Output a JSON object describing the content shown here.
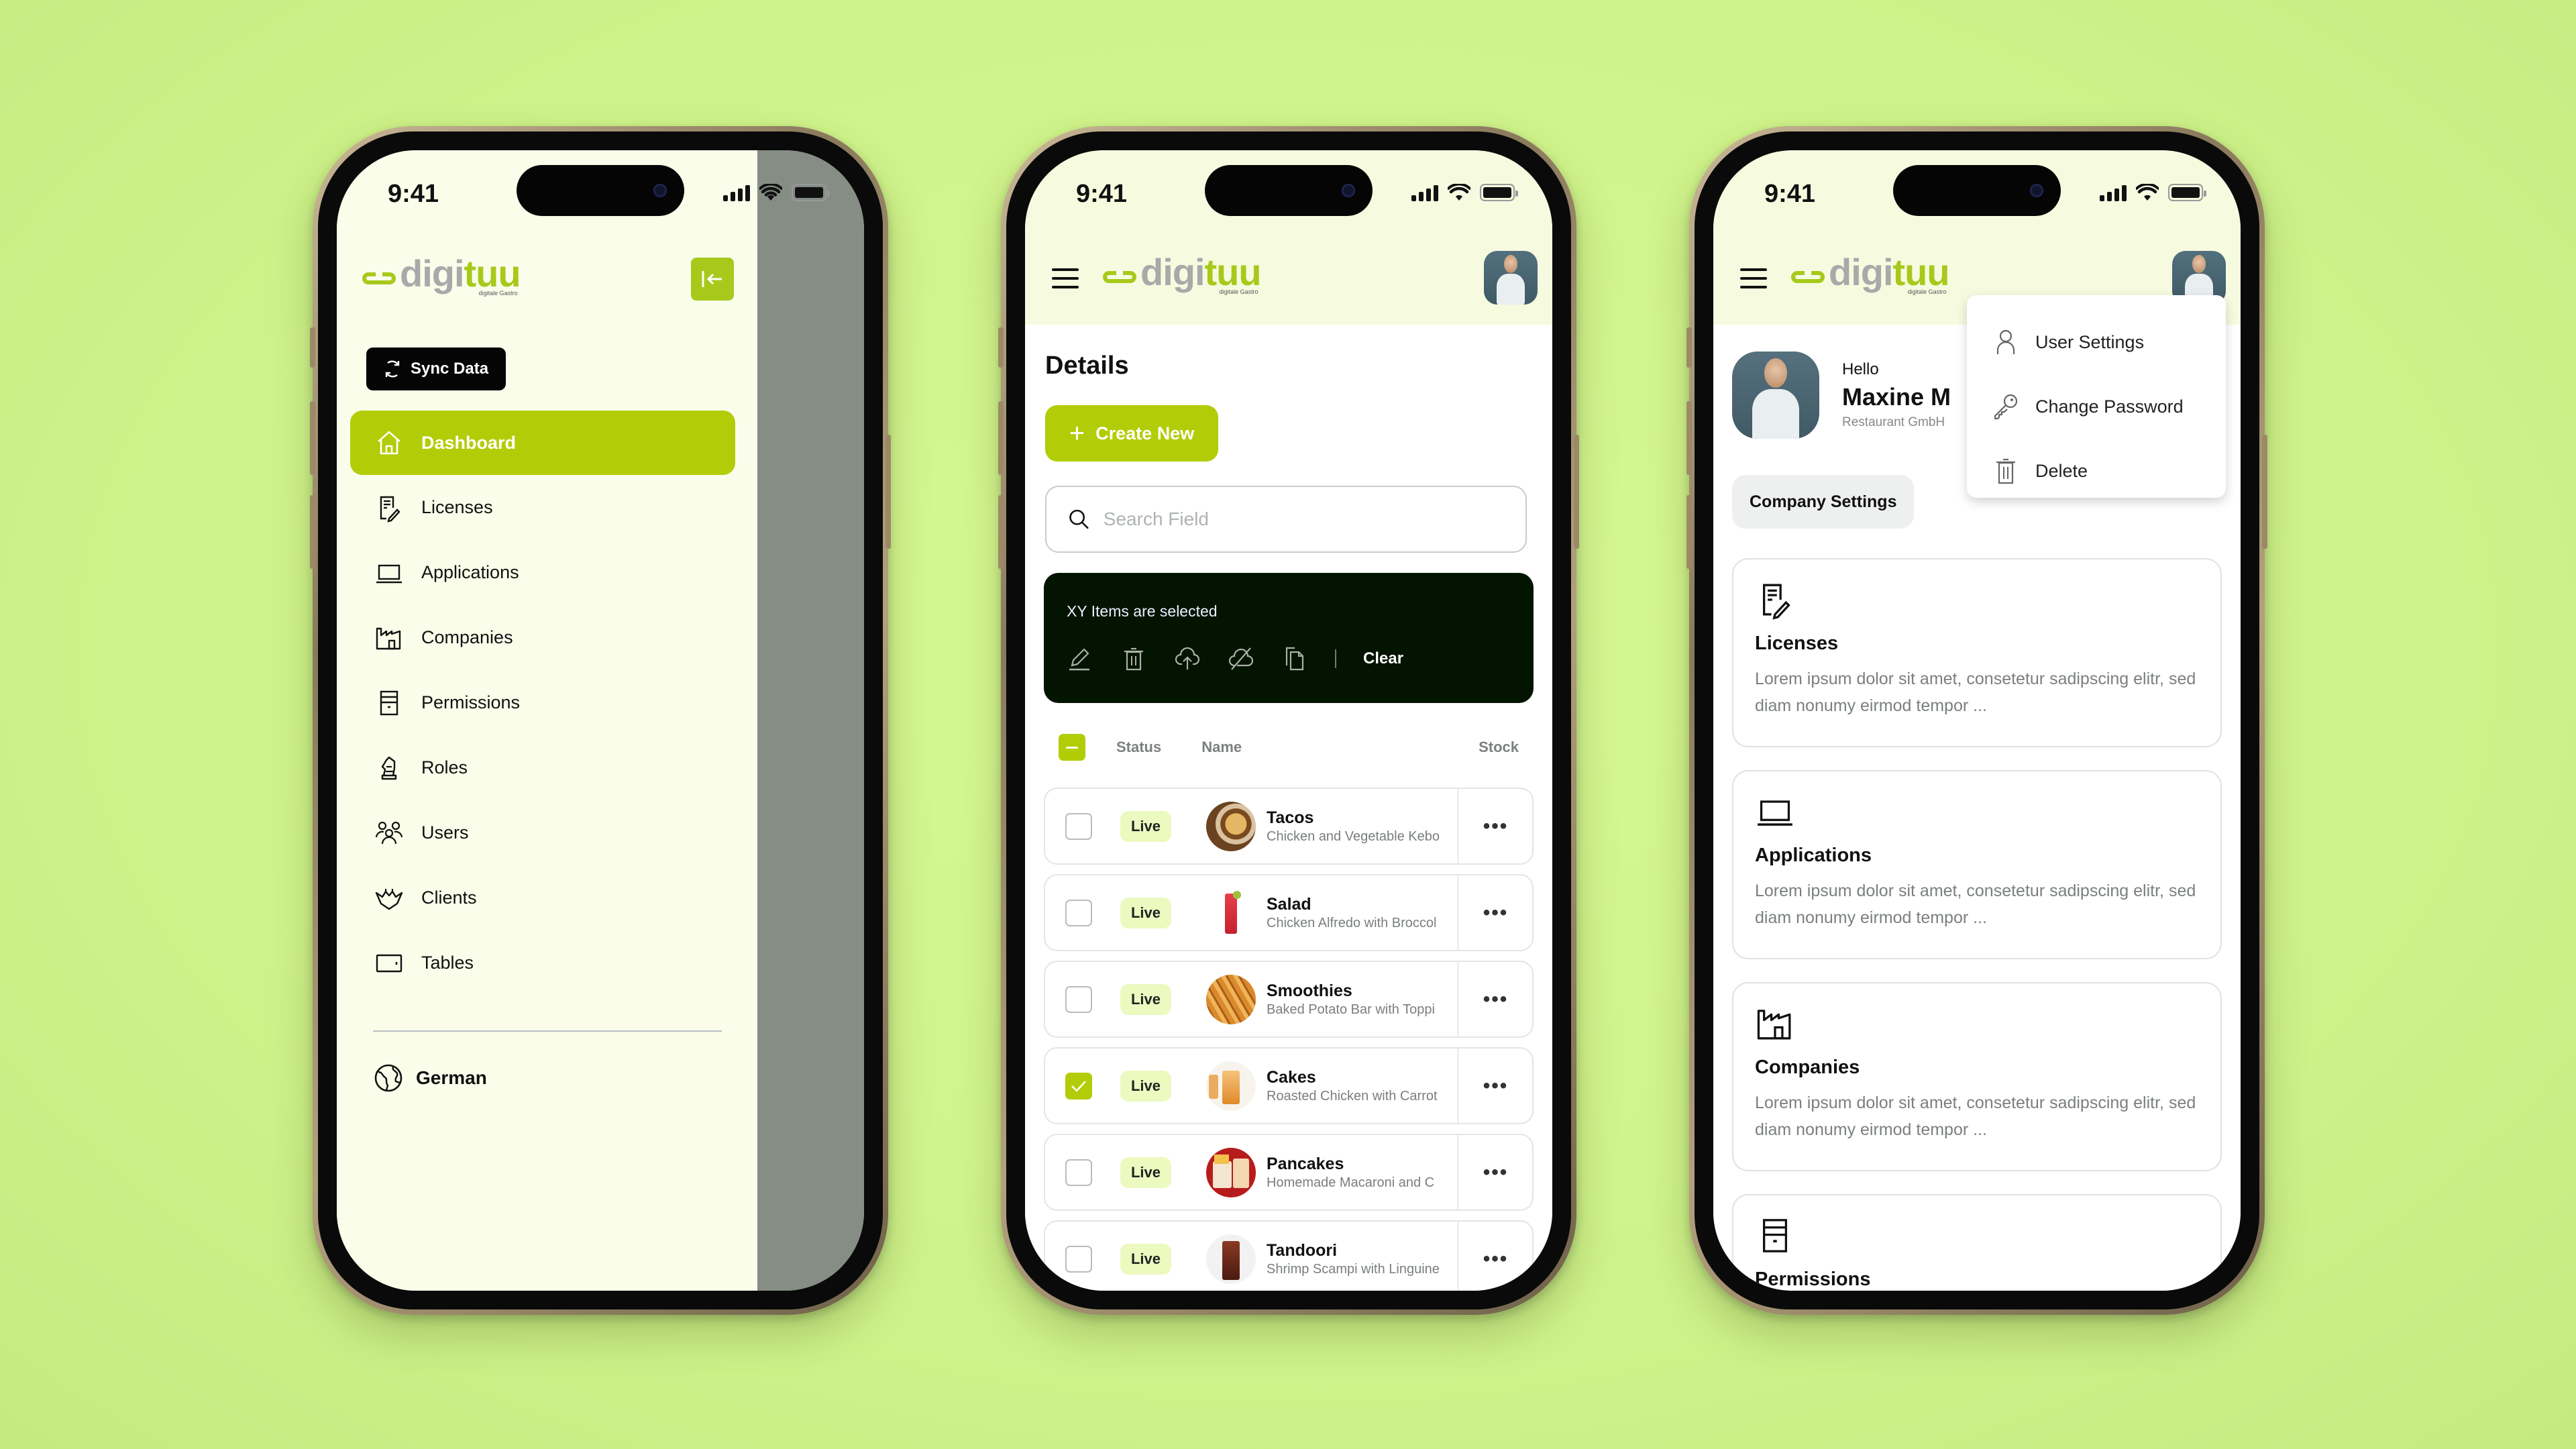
{
  "status_bar": {
    "time": "9:41"
  },
  "brand": {
    "name_part1": "digi",
    "name_part2": "tuu",
    "tagline": "digitale Gastro",
    "accent": "#b2cd07",
    "background": "#d4f78f"
  },
  "phone1": {
    "collapse_icon": "collapse-left-icon",
    "sync_button": "Sync Data",
    "nav": [
      {
        "label": "Dashboard",
        "icon": "home-icon",
        "active": true
      },
      {
        "label": "Licenses",
        "icon": "license-icon",
        "active": false
      },
      {
        "label": "Applications",
        "icon": "laptop-icon",
        "active": false
      },
      {
        "label": "Companies",
        "icon": "factory-icon",
        "active": false
      },
      {
        "label": "Permissions",
        "icon": "cabinet-icon",
        "active": false
      },
      {
        "label": "Roles",
        "icon": "chess-knight-icon",
        "active": false
      },
      {
        "label": "Users",
        "icon": "users-icon",
        "active": false
      },
      {
        "label": "Clients",
        "icon": "crown-icon",
        "active": false
      },
      {
        "label": "Tables",
        "icon": "table-icon",
        "active": false
      }
    ],
    "language": "German"
  },
  "phone2": {
    "title": "Details",
    "create_button": "Create New",
    "search": {
      "placeholder": "Search Field",
      "value": ""
    },
    "selection_bar": {
      "text": "XY Items are selected",
      "actions": [
        "edit-icon",
        "trash-icon",
        "cloud-upload-icon",
        "cloud-off-icon",
        "copy-icon"
      ],
      "clear_label": "Clear"
    },
    "table": {
      "columns": [
        "Status",
        "Name",
        "Stock"
      ],
      "rows": [
        {
          "checked": false,
          "status": "Live",
          "name": "Tacos",
          "description": "Chicken and Vegetable Kebo"
        },
        {
          "checked": false,
          "status": "Live",
          "name": "Salad",
          "description": "Chicken Alfredo with Broccol"
        },
        {
          "checked": false,
          "status": "Live",
          "name": "Smoothies",
          "description": "Baked Potato Bar with Toppi"
        },
        {
          "checked": true,
          "status": "Live",
          "name": "Cakes",
          "description": "Roasted Chicken with Carrot"
        },
        {
          "checked": false,
          "status": "Live",
          "name": "Pancakes",
          "description": "Homemade Macaroni and C"
        },
        {
          "checked": false,
          "status": "Live",
          "name": "Tandoori",
          "description": "Shrimp Scampi with Linguine"
        }
      ],
      "row_menu": "•••"
    }
  },
  "phone3": {
    "greeting": "Hello",
    "user_name": "Maxine M",
    "company": "Restaurant GmbH",
    "company_settings_button": "Company Settings",
    "dropdown": [
      {
        "label": "User Settings",
        "icon": "user-icon"
      },
      {
        "label": "Change Password",
        "icon": "key-icon"
      },
      {
        "label": "Delete",
        "icon": "trash-icon"
      }
    ],
    "cards": [
      {
        "title": "Licenses",
        "icon": "license-icon",
        "description": "Lorem ipsum dolor sit amet, consetetur sadipscing elitr, sed diam nonumy eirmod tempor ..."
      },
      {
        "title": "Applications",
        "icon": "laptop-icon",
        "description": "Lorem ipsum dolor sit amet, consetetur sadipscing elitr, sed diam nonumy eirmod tempor ..."
      },
      {
        "title": "Companies",
        "icon": "factory-icon",
        "description": "Lorem ipsum dolor sit amet, consetetur sadipscing elitr, sed diam nonumy eirmod tempor ..."
      },
      {
        "title": "Permissions",
        "icon": "cabinet-icon",
        "description": ""
      }
    ]
  }
}
